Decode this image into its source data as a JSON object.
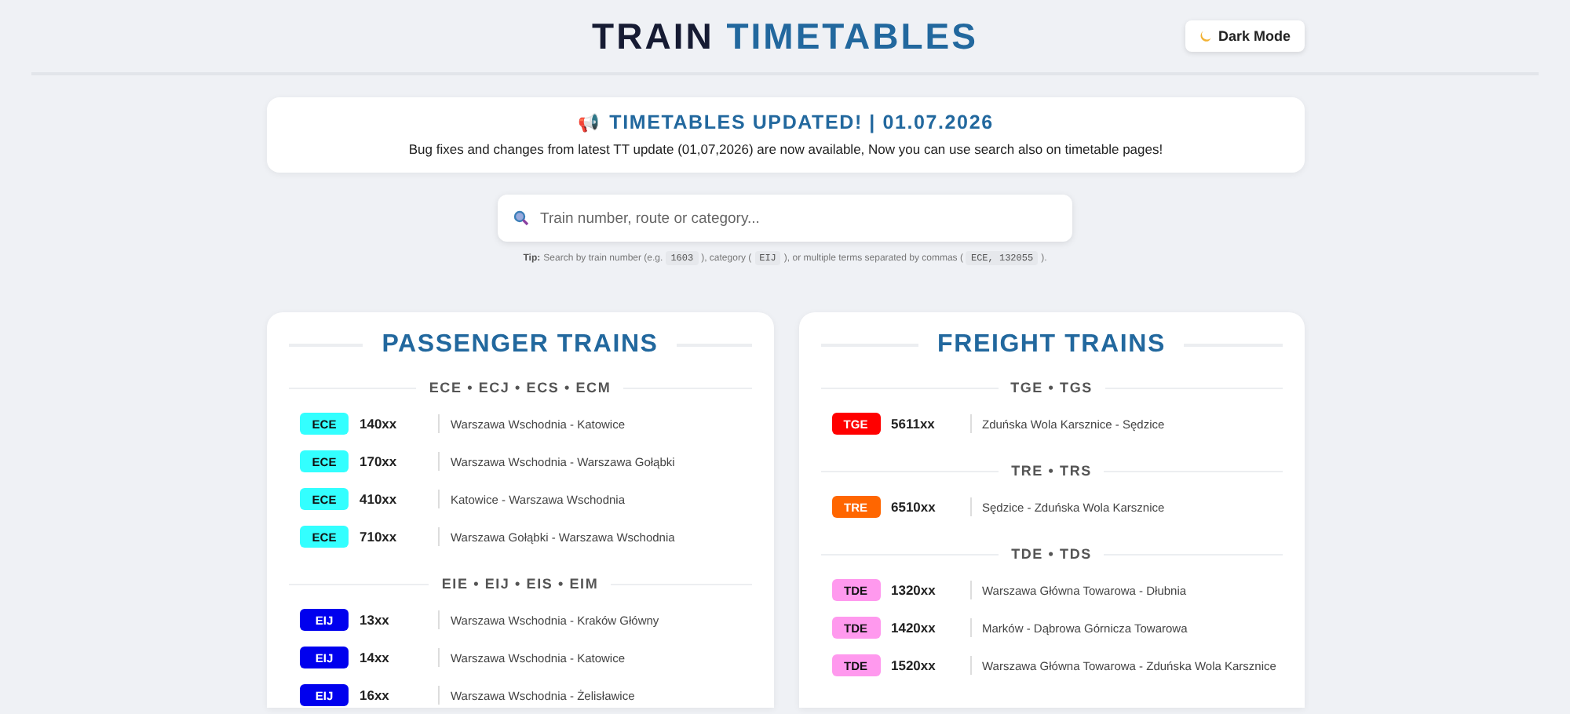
{
  "header": {
    "title_dark": "TRAIN",
    "title_accent": "TIMETABLES",
    "theme_button": {
      "label": "Dark Mode"
    }
  },
  "notice": {
    "icon": "📢",
    "title": "TIMETABLES UPDATED! | 01.07.2026",
    "text": "Bug fixes and changes from latest TT update (01,07,2026) are now available, Now you can use search also on timetable pages!"
  },
  "search": {
    "placeholder": "Train number, route or category...",
    "tip": [
      {
        "kind": "bold",
        "text": "Tip:"
      },
      {
        "kind": "text",
        "text": "Search by train number (e.g."
      },
      {
        "kind": "code",
        "text": "1603"
      },
      {
        "kind": "text",
        "text": "), category ("
      },
      {
        "kind": "code",
        "text": "EIJ"
      },
      {
        "kind": "text",
        "text": "), or multiple terms separated by commas ("
      },
      {
        "kind": "code",
        "text": "ECE, 132055"
      },
      {
        "kind": "text",
        "text": ")."
      }
    ]
  },
  "panels": [
    {
      "title": "PASSENGER TRAINS",
      "groups": [
        {
          "heading": "ECE • ECJ • ECS • ECM",
          "trains": [
            {
              "category": "ECE",
              "color": "#33ffff",
              "number": "140xx",
              "route": "Warszawa Wschodnia - Katowice"
            },
            {
              "category": "ECE",
              "color": "#33ffff",
              "number": "170xx",
              "route": "Warszawa Wschodnia - Warszawa Gołąbki"
            },
            {
              "category": "ECE",
              "color": "#33ffff",
              "number": "410xx",
              "route": "Katowice - Warszawa Wschodnia"
            },
            {
              "category": "ECE",
              "color": "#33ffff",
              "number": "710xx",
              "route": "Warszawa Gołąbki - Warszawa Wschodnia"
            }
          ]
        },
        {
          "heading": "EIE • EIJ • EIS • EIM",
          "trains": [
            {
              "category": "EIJ",
              "color": "#0000ee",
              "number": "13xx",
              "route": "Warszawa Wschodnia - Kraków Główny"
            },
            {
              "category": "EIJ",
              "color": "#0000ee",
              "number": "14xx",
              "route": "Warszawa Wschodnia - Katowice"
            },
            {
              "category": "EIJ",
              "color": "#0000ee",
              "number": "16xx",
              "route": "Warszawa Wschodnia - Żelisławice"
            }
          ]
        }
      ]
    },
    {
      "title": "FREIGHT TRAINS",
      "groups": [
        {
          "heading": "TGE • TGS",
          "trains": [
            {
              "category": "TGE",
              "color": "#ff0000",
              "number": "5611xx",
              "route": "Zduńska Wola Karsznice - Sędzice"
            }
          ]
        },
        {
          "heading": "TRE • TRS",
          "trains": [
            {
              "category": "TRE",
              "color": "#ff6600",
              "number": "6510xx",
              "route": "Sędzice - Zduńska Wola Karsznice"
            }
          ]
        },
        {
          "heading": "TDE • TDS",
          "trains": [
            {
              "category": "TDE",
              "color": "#ff99ee",
              "number": "1320xx",
              "route": "Warszawa Główna Towarowa - Dłubnia"
            },
            {
              "category": "TDE",
              "color": "#ff99ee",
              "number": "1420xx",
              "route": "Marków - Dąbrowa Górnicza Towarowa"
            },
            {
              "category": "TDE",
              "color": "#ff99ee",
              "number": "1520xx",
              "route": "Warszawa Główna Towarowa - Zduńska Wola Karsznice"
            }
          ]
        }
      ]
    }
  ]
}
